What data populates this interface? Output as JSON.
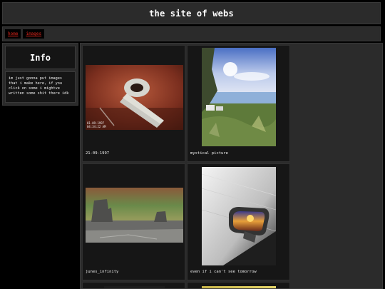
{
  "site": {
    "title": "the site of webs"
  },
  "nav": {
    "links": [
      {
        "label": "home"
      },
      {
        "label": "images"
      }
    ]
  },
  "sidebar": {
    "title": "Info",
    "text": "im just gonna put images that i make here, if you click on some i mightve written some shit there idk"
  },
  "gallery": {
    "items": [
      {
        "caption": "21-09-1997",
        "stamp": "01-09-1997\n04:34:22 AM",
        "icon": "vhs-pipe-image"
      },
      {
        "caption": "mystical picture",
        "icon": "lake-landscape-image"
      },
      {
        "caption": "junes_infinity",
        "icon": "desert-buttes-image"
      },
      {
        "caption": "even if i can't see tomorrow",
        "icon": "car-mirror-sunset-image"
      }
    ]
  },
  "colors": {
    "link": "#e0261c",
    "panel": "#2b2b2b",
    "card": "#161616",
    "background": "#000000"
  }
}
